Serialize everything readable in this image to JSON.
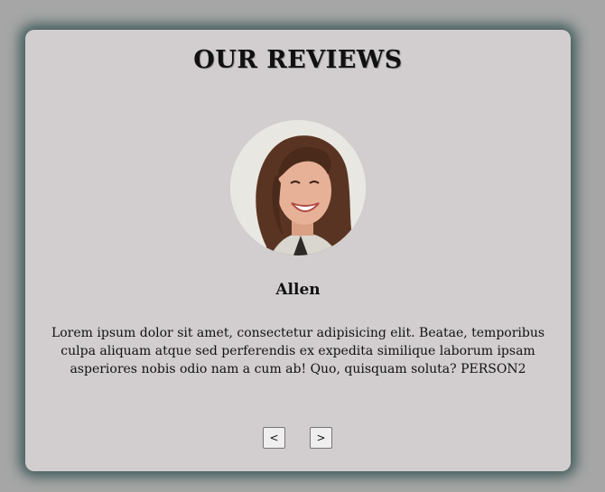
{
  "reviews": {
    "title": "OUR REVIEWS",
    "avatar_icon": "person-photo",
    "name": "Allen",
    "text": "Lorem ipsum dolor sit amet, consectetur adipisicing elit. Beatae, temporibus culpa aliquam atque sed perferendis ex expedita similique laborum ipsam asperiores nobis odio nam a cum ab! Quo, quisquam soluta? PERSON2",
    "prev_label": "<",
    "next_label": ">"
  },
  "colors": {
    "page_background": "#a5a6a5",
    "card_background": "#d2cecf",
    "card_shadow": "#3f5a5a"
  }
}
